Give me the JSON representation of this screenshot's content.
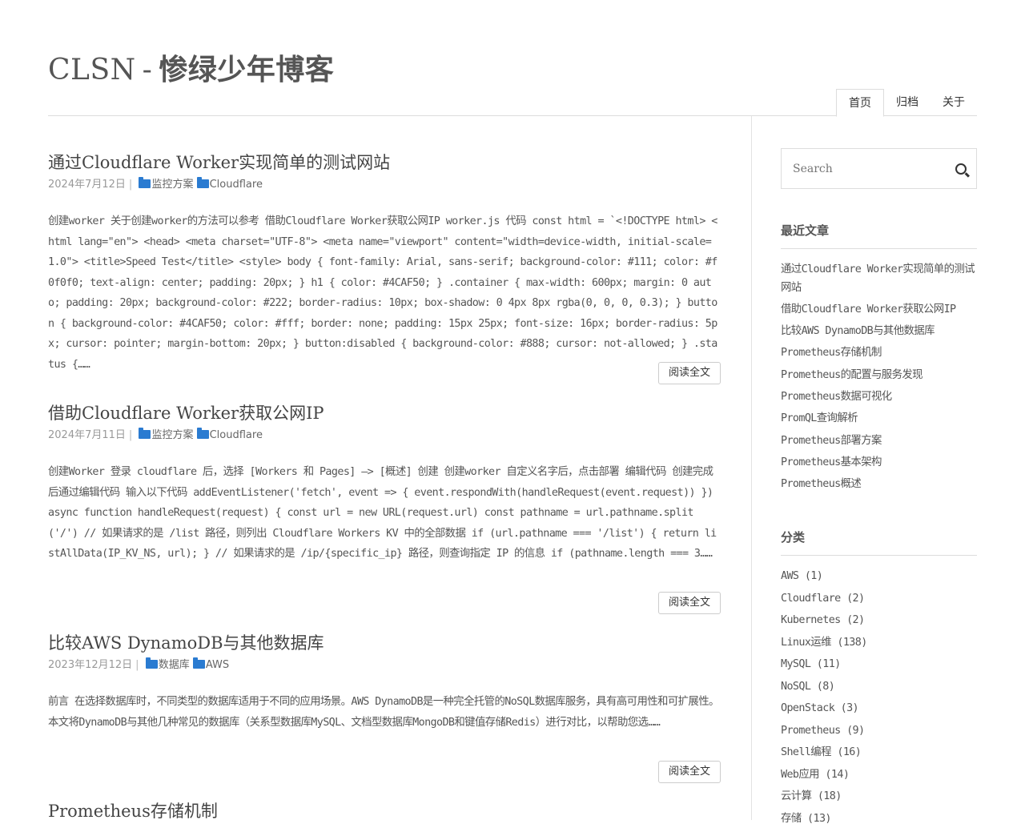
{
  "site": {
    "title_latin": "CLSN",
    "title_sep": "-",
    "title_cn": "惨绿少年博客"
  },
  "nav": [
    {
      "label": "首页"
    },
    {
      "label": "归档"
    },
    {
      "label": "关于"
    }
  ],
  "posts": [
    {
      "title": "通过Cloudflare Worker实现简单的测试网站",
      "date": "2024年7月12日",
      "categories": [
        "监控方案",
        "Cloudflare"
      ],
      "excerpt": "创建worker 关于创建worker的方法可以参考 借助Cloudflare Worker获取公网IP worker.js 代码 const html = `<!DOCTYPE html> <html lang=\"en\"> <head> <meta charset=\"UTF-8\"> <meta name=\"viewport\" content=\"width=device-width, initial-scale=1.0\"> <title>Speed Test</title> <style> body { font-family: Arial, sans-serif; background-color: #111; color: #f0f0f0; text-align: center; padding: 20px; } h1 { color: #4CAF50; } .container { max-width: 600px; margin: 0 auto; padding: 20px; background-color: #222; border-radius: 10px; box-shadow: 0 4px 8px rgba(0, 0, 0, 0.3); } button { background-color: #4CAF50; color: #fff; border: none; padding: 15px 25px; font-size: 16px; border-radius: 5px; cursor: pointer; margin-bottom: 20px; } button:disabled { background-color: #888; cursor: not-allowed; } .status {……",
      "more": "阅读全文"
    },
    {
      "title": "借助Cloudflare Worker获取公网IP",
      "date": "2024年7月11日",
      "categories": [
        "监控方案",
        "Cloudflare"
      ],
      "excerpt": "创建Worker 登录 cloudflare 后，选择 [Workers 和 Pages] —> [概述] 创建 创建worker 自定义名字后，点击部署 编辑代码 创建完成后通过编辑代码 输入以下代码 addEventListener('fetch', event => { event.respondWith(handleRequest(event.request)) }) async function handleRequest(request) { const url = new URL(request.url) const pathname = url.pathname.split('/') // 如果请求的是 /list 路径，则列出 Cloudflare Workers KV 中的全部数据 if (url.pathname === '/list') { return listAllData(IP_KV_NS, url); } // 如果请求的是 /ip/{specific_ip} 路径，则查询指定 IP 的信息 if (pathname.length === 3……",
      "more": "阅读全文"
    },
    {
      "title": "比较AWS DynamoDB与其他数据库",
      "date": "2023年12月12日",
      "categories": [
        "数据库",
        "AWS"
      ],
      "excerpt": "前言 在选择数据库时，不同类型的数据库适用于不同的应用场景。AWS DynamoDB是一种完全托管的NoSQL数据库服务，具有高可用性和可扩展性。本文将DynamoDB与其他几种常见的数据库（关系型数据库MySQL、文档型数据库MongoDB和键值存储Redis）进行对比，以帮助您选……",
      "more": "阅读全文"
    },
    {
      "title": "Prometheus存储机制"
    }
  ],
  "sidebar": {
    "search_placeholder": "Search",
    "recent_title": "最近文章",
    "recent": [
      "通过Cloudflare Worker实现简单的测试网站",
      "借助Cloudflare Worker获取公网IP",
      "比较AWS DynamoDB与其他数据库",
      "Prometheus存储机制",
      "Prometheus的配置与服务发现",
      "Prometheus数据可视化",
      "PromQL查询解析",
      "Prometheus部署方案",
      "Prometheus基本架构",
      "Prometheus概述"
    ],
    "cat_title": "分类",
    "categories": [
      "AWS (1)",
      "Cloudflare (2)",
      "Kubernetes (2)",
      "Linux运维 (138)",
      "MySQL (11)",
      "NoSQL (8)",
      "OpenStack (3)",
      "Prometheus (9)",
      "Shell编程 (16)",
      "Web应用 (14)",
      "云计算 (18)",
      "存储 (13)"
    ]
  }
}
